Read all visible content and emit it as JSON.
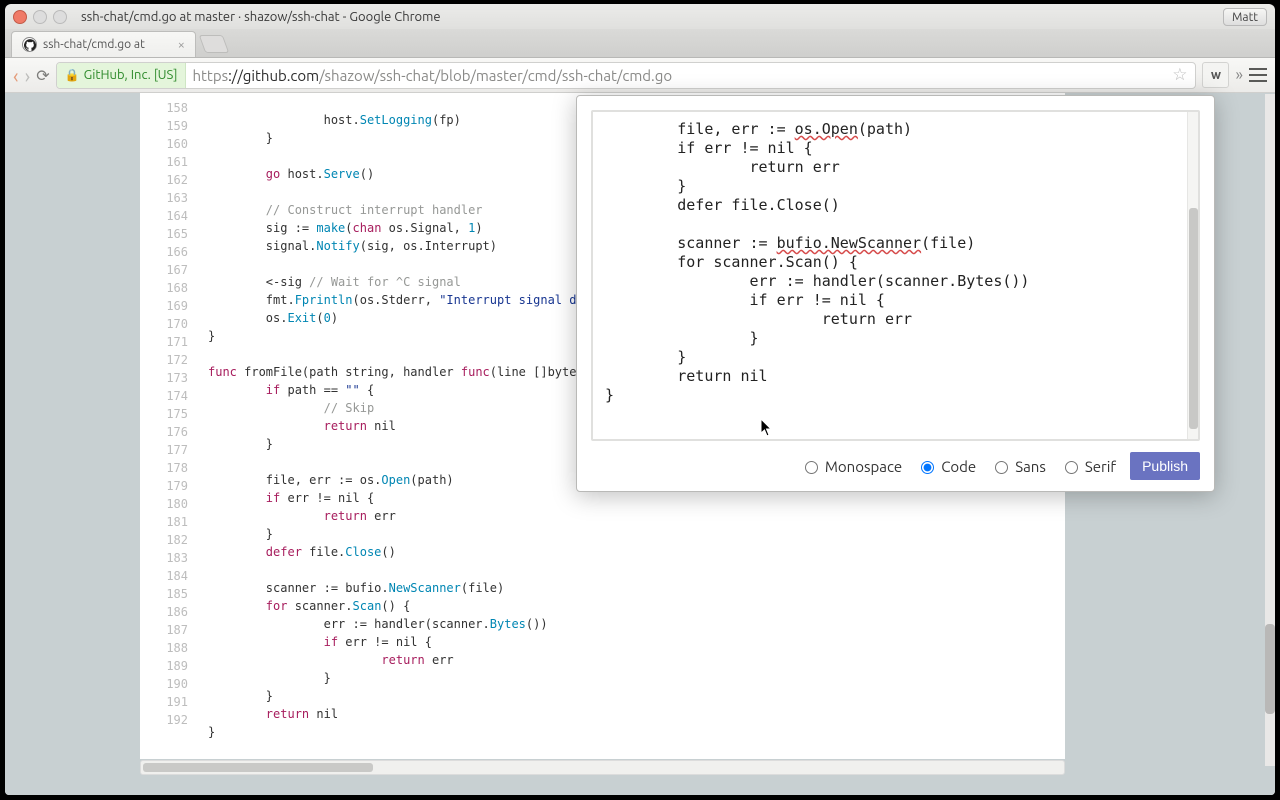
{
  "os": {
    "window_title": "ssh-chat/cmd.go at master · shazow/ssh-chat - Google Chrome",
    "user": "Matt"
  },
  "browser": {
    "tab_title": "ssh-chat/cmd.go at",
    "ssl_identity": "GitHub, Inc. [US]",
    "url_scheme": "https",
    "url_host": "://github.com",
    "url_path": "/shazow/ssh-chat/blob/master/cmd/ssh-chat/cmd.go",
    "ext_label": "w"
  },
  "code": {
    "first_line": 158,
    "lines": [
      "                host.SetLogging(fp)",
      "        }",
      "",
      "        go host.Serve()",
      "",
      "        // Construct interrupt handler",
      "        sig := make(chan os.Signal, 1)",
      "        signal.Notify(sig, os.Interrupt)",
      "",
      "        <-sig // Wait for ^C signal",
      "        fmt.Fprintln(os.Stderr, \"Interrupt signal d",
      "        os.Exit(0)",
      "}",
      "",
      "func fromFile(path string, handler func(line []byte",
      "        if path == \"\" {",
      "                // Skip",
      "                return nil",
      "        }",
      "",
      "        file, err := os.Open(path)",
      "        if err != nil {",
      "                return err",
      "        }",
      "        defer file.Close()",
      "",
      "        scanner := bufio.NewScanner(file)",
      "        for scanner.Scan() {",
      "                err := handler(scanner.Bytes())",
      "                if err != nil {",
      "                        return err",
      "                }",
      "        }",
      "        return nil",
      "}"
    ],
    "highlight_from": 172,
    "highlight_to": 192
  },
  "popup": {
    "text": "        file, err := os.Open(path)\n        if err != nil {\n                return err\n        }\n        defer file.Close()\n\n        scanner := bufio.NewScanner(file)\n        for scanner.Scan() {\n                err := handler(scanner.Bytes())\n                if err != nil {\n                        return err\n                }\n        }\n        return nil\n}",
    "fonts": [
      "Monospace",
      "Code",
      "Sans",
      "Serif"
    ],
    "selected_font": "Code",
    "publish_label": "Publish"
  }
}
